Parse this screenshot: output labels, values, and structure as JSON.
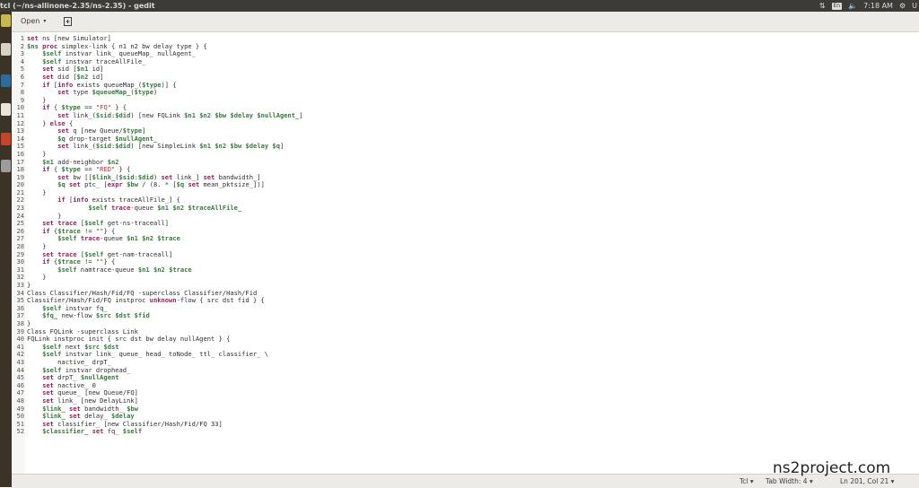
{
  "window": {
    "title": "tcl (~/ns-allinone-2.35/ns-2.35) - gedit"
  },
  "tray": {
    "keyboard": "En",
    "time": "7:18 AM",
    "user": "U"
  },
  "toolbar": {
    "open_label": "Open"
  },
  "status": {
    "lang": "Tcl",
    "tab_width": "Tab Width: 4",
    "position": "Ln 201, Col 21"
  },
  "watermark": "ns2project.com",
  "code_lines": [
    {
      "n": "1",
      "t": "<span class=\"k\">set</span> ns [new Simulator]"
    },
    {
      "n": "2",
      "t": "<span class=\"v\">$ns</span> <span class=\"k\">proc</span> simplex-link { n1 n2 bw delay type } {"
    },
    {
      "n": "3",
      "t": "    <span class=\"v\">$self</span> instvar link_ queueMap_ nullAgent_"
    },
    {
      "n": "4",
      "t": "    <span class=\"v\">$self</span> instvar traceAllFile_"
    },
    {
      "n": "5",
      "t": "    <span class=\"k\">set</span> sid [<span class=\"v\">$n1</span> id]"
    },
    {
      "n": "6",
      "t": "    <span class=\"k\">set</span> did [<span class=\"v\">$n2</span> id]"
    },
    {
      "n": "7",
      "t": "    <span class=\"k\">if</span> [<span class=\"k\">info</span> exists queueMap_(<span class=\"v\">$type</span>)] {"
    },
    {
      "n": "8",
      "t": "        <span class=\"k\">set</span> type <span class=\"v\">$queueMap_</span>(<span class=\"v\">$type</span>)"
    },
    {
      "n": "9",
      "t": "    }"
    },
    {
      "n": "10",
      "t": "    <span class=\"k\">if</span> { <span class=\"v\">$type</span> == <span class=\"s\">\"FQ\"</span> } {"
    },
    {
      "n": "11",
      "t": "        <span class=\"k\">set</span> link_(<span class=\"v\">$sid</span>:<span class=\"v\">$did</span>) [new FQLink <span class=\"v\">$n1</span> <span class=\"v\">$n2</span> <span class=\"v\">$bw</span> <span class=\"v\">$delay</span> <span class=\"v\">$nullAgent_</span>]"
    },
    {
      "n": "12",
      "t": "    } <span class=\"k\">else</span> {"
    },
    {
      "n": "13",
      "t": "        <span class=\"k\">set</span> q [new Queue/<span class=\"v\">$type</span>]"
    },
    {
      "n": "14",
      "t": "        <span class=\"v\">$q</span> drop-target <span class=\"v\">$nullAgent_</span>"
    },
    {
      "n": "15",
      "t": "        <span class=\"k\">set</span> link_(<span class=\"v\">$sid</span>:<span class=\"v\">$did</span>) [new SimpleLink <span class=\"v\">$n1</span> <span class=\"v\">$n2</span> <span class=\"v\">$bw</span> <span class=\"v\">$delay</span> <span class=\"v\">$q</span>]"
    },
    {
      "n": "16",
      "t": "    }"
    },
    {
      "n": "17",
      "t": "    <span class=\"v\">$n1</span> add-neighbor <span class=\"v\">$n2</span>"
    },
    {
      "n": "18",
      "t": "    <span class=\"k\">if</span> { <span class=\"v\">$type</span> == <span class=\"s\">\"RED\"</span> } {"
    },
    {
      "n": "19",
      "t": "        <span class=\"k\">set</span> bw [[<span class=\"v\">$link_</span>(<span class=\"v\">$sid</span>:<span class=\"v\">$did</span>) <span class=\"k\">set</span> link_] <span class=\"k\">set</span> bandwidth_]"
    },
    {
      "n": "20",
      "t": "        <span class=\"v\">$q</span> <span class=\"k\">set</span> ptc_ [<span class=\"k\">expr</span> <span class=\"v\">$bw</span> / (8. * [<span class=\"v\">$q</span> <span class=\"k\">set</span> mean_pktsize_])]"
    },
    {
      "n": "21",
      "t": "    }"
    },
    {
      "n": "22",
      "t": "        <span class=\"k\">if</span> [<span class=\"k\">info</span> exists traceAllFile_] {"
    },
    {
      "n": "23",
      "t": "                <span class=\"v\">$self</span> <span class=\"k\">trace</span>-queue <span class=\"v\">$n1</span> <span class=\"v\">$n2</span> <span class=\"v\">$traceAllFile_</span>"
    },
    {
      "n": "24",
      "t": "        }"
    },
    {
      "n": "25",
      "t": "    <span class=\"k\">set</span> <span class=\"k\">trace</span> [<span class=\"v\">$self</span> get-ns-traceall]"
    },
    {
      "n": "26",
      "t": "    <span class=\"k\">if</span> {<span class=\"v\">$trace</span> != <span class=\"s\">\"\"</span>} {"
    },
    {
      "n": "27",
      "t": "        <span class=\"v\">$self</span> <span class=\"k\">trace</span>-queue <span class=\"v\">$n1</span> <span class=\"v\">$n2</span> <span class=\"v\">$trace</span>"
    },
    {
      "n": "28",
      "t": "    }"
    },
    {
      "n": "29",
      "t": "    <span class=\"k\">set</span> <span class=\"k\">trace</span> [<span class=\"v\">$self</span> get-nam-traceall]"
    },
    {
      "n": "30",
      "t": "    <span class=\"k\">if</span> {<span class=\"v\">$trace</span> != <span class=\"s\">\"\"</span>} {"
    },
    {
      "n": "31",
      "t": "        <span class=\"v\">$self</span> namtrace-queue <span class=\"v\">$n1</span> <span class=\"v\">$n2</span> <span class=\"v\">$trace</span>"
    },
    {
      "n": "32",
      "t": "    }"
    },
    {
      "n": "33",
      "t": "}"
    },
    {
      "n": "34",
      "t": "Class Classifier/Hash/Fid/FQ -superclass Classifier/Hash/Fid"
    },
    {
      "n": "35",
      "t": "Classifier/Hash/Fid/FQ instproc <span class=\"k\">unknown</span>-flow { src dst fid } {"
    },
    {
      "n": "36",
      "t": "    <span class=\"v\">$self</span> instvar fq_"
    },
    {
      "n": "37",
      "t": "    <span class=\"v\">$fq_</span> new-flow <span class=\"v\">$src</span> <span class=\"v\">$dst</span> <span class=\"v\">$fid</span>"
    },
    {
      "n": "38",
      "t": "}"
    },
    {
      "n": "39",
      "t": "Class FQLink -superclass Link"
    },
    {
      "n": "40",
      "t": "FQLink instproc init { src dst bw delay nullAgent } {"
    },
    {
      "n": "41",
      "t": "    <span class=\"v\">$self</span> next <span class=\"v\">$src</span> <span class=\"v\">$dst</span>"
    },
    {
      "n": "42",
      "t": "    <span class=\"v\">$self</span> instvar link_ queue_ head_ toNode_ ttl_ classifier_ \\"
    },
    {
      "n": "43",
      "t": "        nactive_ drpT_"
    },
    {
      "n": "44",
      "t": "    <span class=\"v\">$self</span> instvar drophead_"
    },
    {
      "n": "45",
      "t": "    <span class=\"k\">set</span> drpT_ <span class=\"v\">$nullAgent</span>"
    },
    {
      "n": "46",
      "t": "    <span class=\"k\">set</span> nactive_ 0"
    },
    {
      "n": "47",
      "t": "    <span class=\"k\">set</span> queue_ [new Queue/FQ]"
    },
    {
      "n": "48",
      "t": "    <span class=\"k\">set</span> link_ [new DelayLink]"
    },
    {
      "n": "49",
      "t": "    <span class=\"v\">$link_</span> <span class=\"k\">set</span> bandwidth_ <span class=\"v\">$bw</span>"
    },
    {
      "n": "50",
      "t": "    <span class=\"v\">$link_</span> <span class=\"k\">set</span> delay_ <span class=\"v\">$delay</span>"
    },
    {
      "n": "51",
      "t": "    <span class=\"k\">set</span> classifier_ [new Classifier/Hash/Fid/FQ 33]"
    },
    {
      "n": "52",
      "t": "    <span class=\"v\">$classifier_</span> <span class=\"k\">set</span> fq_ <span class=\"v\">$self</span>"
    }
  ]
}
